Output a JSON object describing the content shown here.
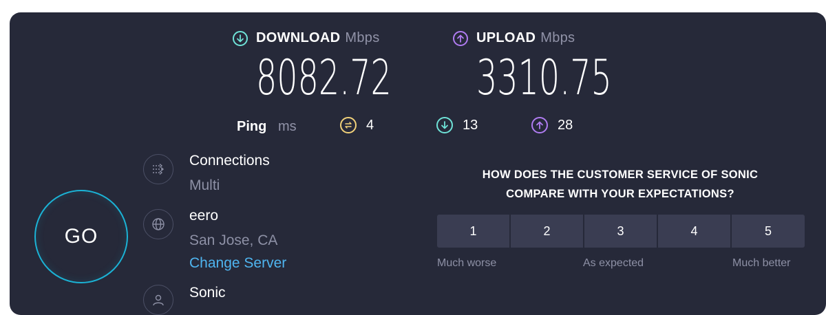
{
  "download": {
    "label": "DOWNLOAD",
    "unit": "Mbps",
    "value": "8082.72",
    "icon": "arrow-down-circle-icon",
    "color": "#6fe3d8"
  },
  "upload": {
    "label": "UPLOAD",
    "unit": "Mbps",
    "value": "3310.75",
    "icon": "arrow-up-circle-icon",
    "color": "#b07cf2"
  },
  "ping": {
    "label": "Ping",
    "unit": "ms",
    "idle": {
      "value": "4",
      "icon": "ping-idle-icon",
      "color": "#f2d27a"
    },
    "download": {
      "value": "13",
      "icon": "ping-download-icon",
      "color": "#6fe3d8"
    },
    "upload": {
      "value": "28",
      "icon": "ping-upload-icon",
      "color": "#b07cf2"
    }
  },
  "go": {
    "label": "GO",
    "ring_color": "#1bb3d6"
  },
  "server": {
    "connections": {
      "title": "Connections",
      "value": "Multi",
      "icon": "connections-icon"
    },
    "host": {
      "title": "eero",
      "location": "San Jose, CA",
      "change_link": "Change Server",
      "icon": "globe-icon"
    },
    "provider": {
      "title": "Sonic",
      "icon": "user-icon"
    }
  },
  "survey": {
    "question_line1": "HOW DOES THE CUSTOMER SERVICE OF SONIC",
    "question_line2": "COMPARE WITH YOUR EXPECTATIONS?",
    "options": [
      "1",
      "2",
      "3",
      "4",
      "5"
    ],
    "low_label": "Much worse",
    "mid_label": "As expected",
    "high_label": "Much better"
  }
}
